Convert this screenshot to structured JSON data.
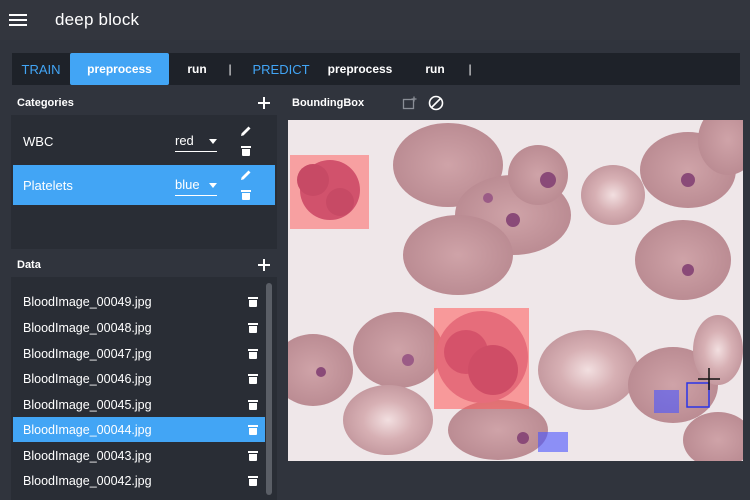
{
  "app": {
    "title": "deep block"
  },
  "toolbar": {
    "train_label": "TRAIN",
    "train_preprocess": "preprocess",
    "train_run": "run",
    "sep": "|",
    "predict_label": "PREDICT",
    "predict_preprocess": "preprocess",
    "predict_run": "run"
  },
  "categories": {
    "title": "Categories",
    "items": [
      {
        "label": "WBC",
        "color": "red",
        "selected": false
      },
      {
        "label": "Platelets",
        "color": "blue",
        "selected": true
      }
    ]
  },
  "data": {
    "title": "Data",
    "files": [
      "BloodImage_00049.jpg",
      "BloodImage_00048.jpg",
      "BloodImage_00047.jpg",
      "BloodImage_00046.jpg",
      "BloodImage_00045.jpg",
      "BloodImage_00044.jpg",
      "BloodImage_00043.jpg",
      "BloodImage_00042.jpg"
    ],
    "selected_index": 5
  },
  "viewer": {
    "title": "BoundingBox"
  },
  "colors": {
    "accent": "#42a5f5",
    "wbc_box": "#ff5a5a",
    "platelet_box": "#4a55ff"
  }
}
